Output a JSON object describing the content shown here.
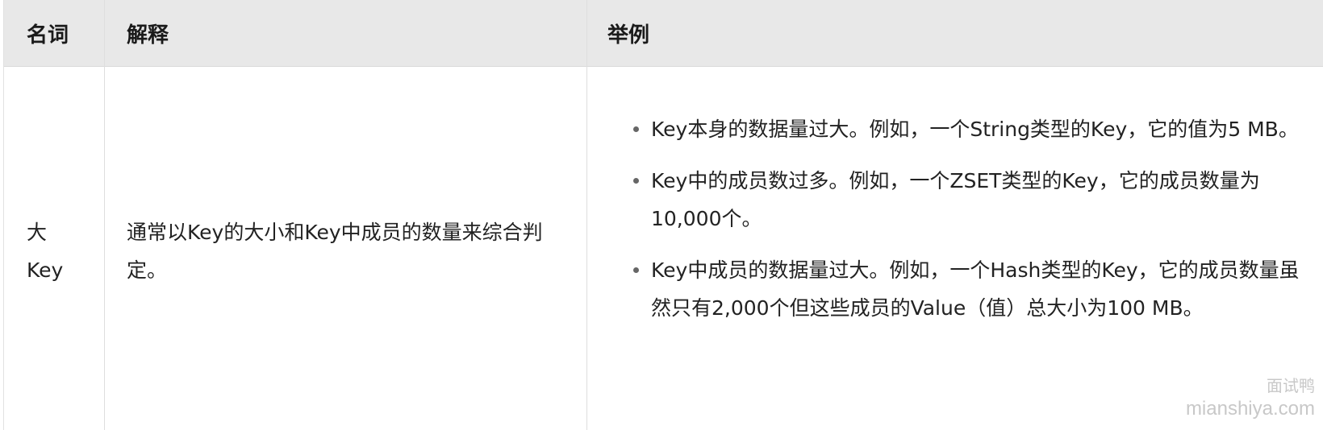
{
  "table": {
    "headers": [
      "名词",
      "解释",
      "举例"
    ],
    "row": {
      "term_line1": "大",
      "term_line2": "Key",
      "explanation": "通常以Key的大小和Key中成员的数量来综合判定。",
      "examples": [
        "Key本身的数据量过大。例如，一个String类型的Key，它的值为5 MB。",
        "Key中的成员数过多。例如，一个ZSET类型的Key，它的成员数量为10,000个。",
        "Key中成员的数据量过大。例如，一个Hash类型的Key，它的成员数量虽然只有2,000个但这些成员的Value（值）总大小为100 MB。"
      ]
    }
  },
  "watermark": {
    "line1": "面试鸭",
    "line2": "mianshiya.com"
  }
}
